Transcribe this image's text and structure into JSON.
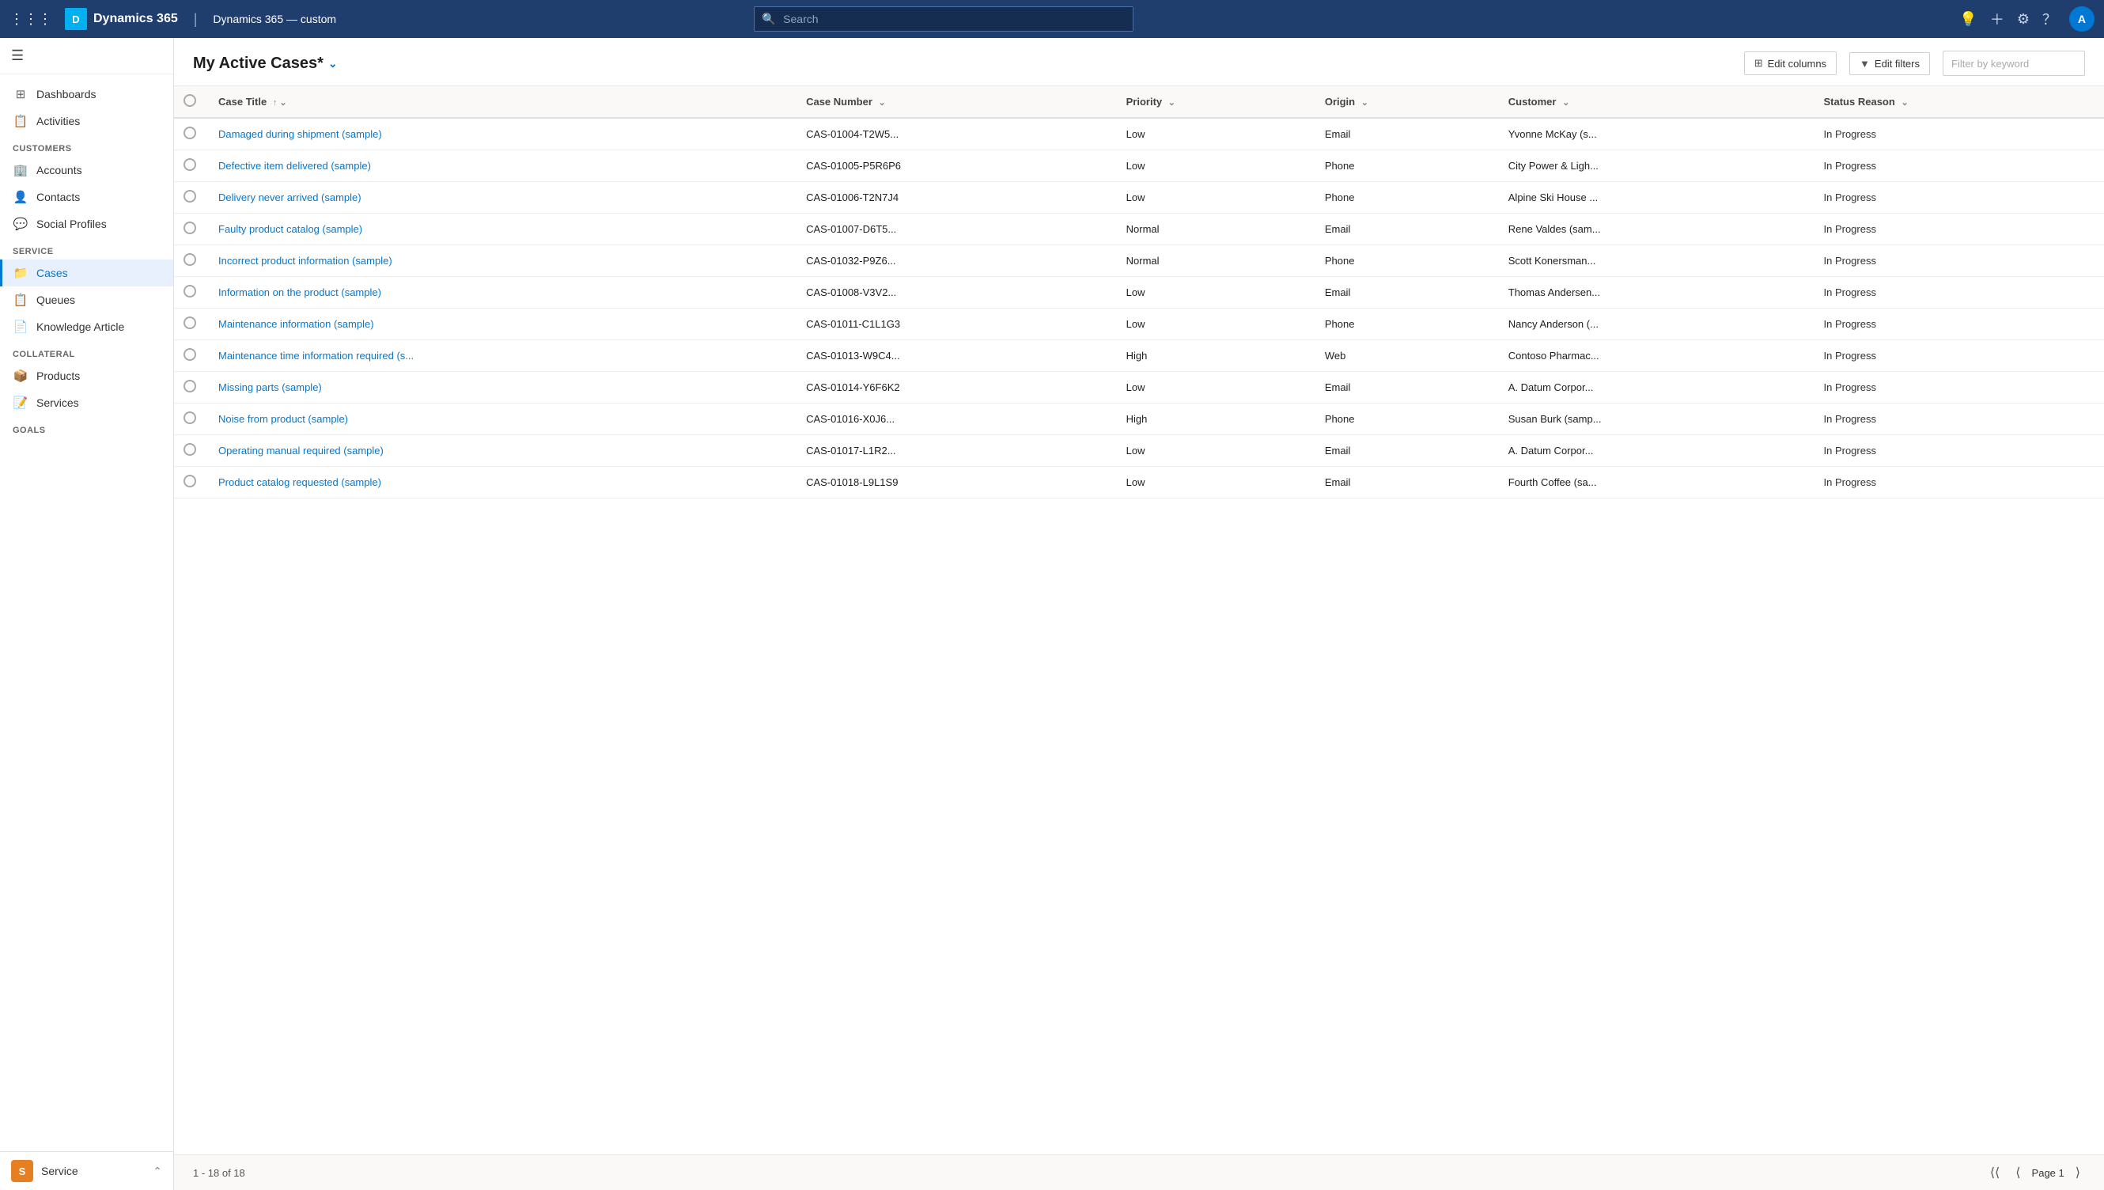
{
  "topnav": {
    "brand_logo": "D",
    "brand_name": "Dynamics 365",
    "app_name": "Dynamics 365 — custom",
    "search_placeholder": "Search"
  },
  "sidebar": {
    "top_items": [
      {
        "id": "dashboards",
        "label": "Dashboards",
        "icon": "⊞"
      },
      {
        "id": "activities",
        "label": "Activities",
        "icon": "📋"
      }
    ],
    "sections": [
      {
        "title": "Customers",
        "items": [
          {
            "id": "accounts",
            "label": "Accounts",
            "icon": "🏢"
          },
          {
            "id": "contacts",
            "label": "Contacts",
            "icon": "👤"
          },
          {
            "id": "social-profiles",
            "label": "Social Profiles",
            "icon": "💬"
          }
        ]
      },
      {
        "title": "Service",
        "items": [
          {
            "id": "cases",
            "label": "Cases",
            "icon": "📁",
            "active": true
          },
          {
            "id": "queues",
            "label": "Queues",
            "icon": "📋"
          },
          {
            "id": "knowledge-article",
            "label": "Knowledge Article",
            "icon": "📄"
          }
        ]
      },
      {
        "title": "Collateral",
        "items": [
          {
            "id": "products",
            "label": "Products",
            "icon": "📦"
          },
          {
            "id": "services",
            "label": "Services",
            "icon": "📝"
          }
        ]
      },
      {
        "title": "Goals",
        "items": []
      }
    ],
    "footer": {
      "icon_letter": "S",
      "label": "Service"
    }
  },
  "content": {
    "title": "My Active Cases*",
    "edit_columns_label": "Edit columns",
    "edit_filters_label": "Edit filters",
    "filter_placeholder": "Filter by keyword",
    "columns": [
      {
        "id": "case-title",
        "label": "Case Title",
        "sortable": true,
        "sort_dir": "asc"
      },
      {
        "id": "case-number",
        "label": "Case Number",
        "sortable": true
      },
      {
        "id": "priority",
        "label": "Priority",
        "sortable": true
      },
      {
        "id": "origin",
        "label": "Origin",
        "sortable": true
      },
      {
        "id": "customer",
        "label": "Customer",
        "sortable": true
      },
      {
        "id": "status-reason",
        "label": "Status Reason",
        "sortable": true
      }
    ],
    "rows": [
      {
        "case_title": "Damaged during shipment (sample)",
        "case_number": "CAS-01004-T2W5...",
        "priority": "Low",
        "origin": "Email",
        "customer": "Yvonne McKay (s...",
        "status_reason": "In Progress"
      },
      {
        "case_title": "Defective item delivered (sample)",
        "case_number": "CAS-01005-P5R6P6",
        "priority": "Low",
        "origin": "Phone",
        "customer": "City Power & Ligh...",
        "status_reason": "In Progress"
      },
      {
        "case_title": "Delivery never arrived (sample)",
        "case_number": "CAS-01006-T2N7J4",
        "priority": "Low",
        "origin": "Phone",
        "customer": "Alpine Ski House ...",
        "status_reason": "In Progress"
      },
      {
        "case_title": "Faulty product catalog (sample)",
        "case_number": "CAS-01007-D6T5...",
        "priority": "Normal",
        "origin": "Email",
        "customer": "Rene Valdes (sam...",
        "status_reason": "In Progress"
      },
      {
        "case_title": "Incorrect product information (sample)",
        "case_number": "CAS-01032-P9Z6...",
        "priority": "Normal",
        "origin": "Phone",
        "customer": "Scott Konersman...",
        "status_reason": "In Progress"
      },
      {
        "case_title": "Information on the product (sample)",
        "case_number": "CAS-01008-V3V2...",
        "priority": "Low",
        "origin": "Email",
        "customer": "Thomas Andersen...",
        "status_reason": "In Progress"
      },
      {
        "case_title": "Maintenance information (sample)",
        "case_number": "CAS-01011-C1L1G3",
        "priority": "Low",
        "origin": "Phone",
        "customer": "Nancy Anderson (...",
        "status_reason": "In Progress"
      },
      {
        "case_title": "Maintenance time information required (s...",
        "case_number": "CAS-01013-W9C4...",
        "priority": "High",
        "origin": "Web",
        "customer": "Contoso Pharmac...",
        "status_reason": "In Progress"
      },
      {
        "case_title": "Missing parts (sample)",
        "case_number": "CAS-01014-Y6F6K2",
        "priority": "Low",
        "origin": "Email",
        "customer": "A. Datum Corpor...",
        "status_reason": "In Progress"
      },
      {
        "case_title": "Noise from product (sample)",
        "case_number": "CAS-01016-X0J6...",
        "priority": "High",
        "origin": "Phone",
        "customer": "Susan Burk (samp...",
        "status_reason": "In Progress"
      },
      {
        "case_title": "Operating manual required (sample)",
        "case_number": "CAS-01017-L1R2...",
        "priority": "Low",
        "origin": "Email",
        "customer": "A. Datum Corpor...",
        "status_reason": "In Progress"
      },
      {
        "case_title": "Product catalog requested (sample)",
        "case_number": "CAS-01018-L9L1S9",
        "priority": "Low",
        "origin": "Email",
        "customer": "Fourth Coffee (sa...",
        "status_reason": "In Progress"
      }
    ],
    "pagination": {
      "record_info": "1 - 18 of 18",
      "page_label": "Page 1"
    }
  }
}
